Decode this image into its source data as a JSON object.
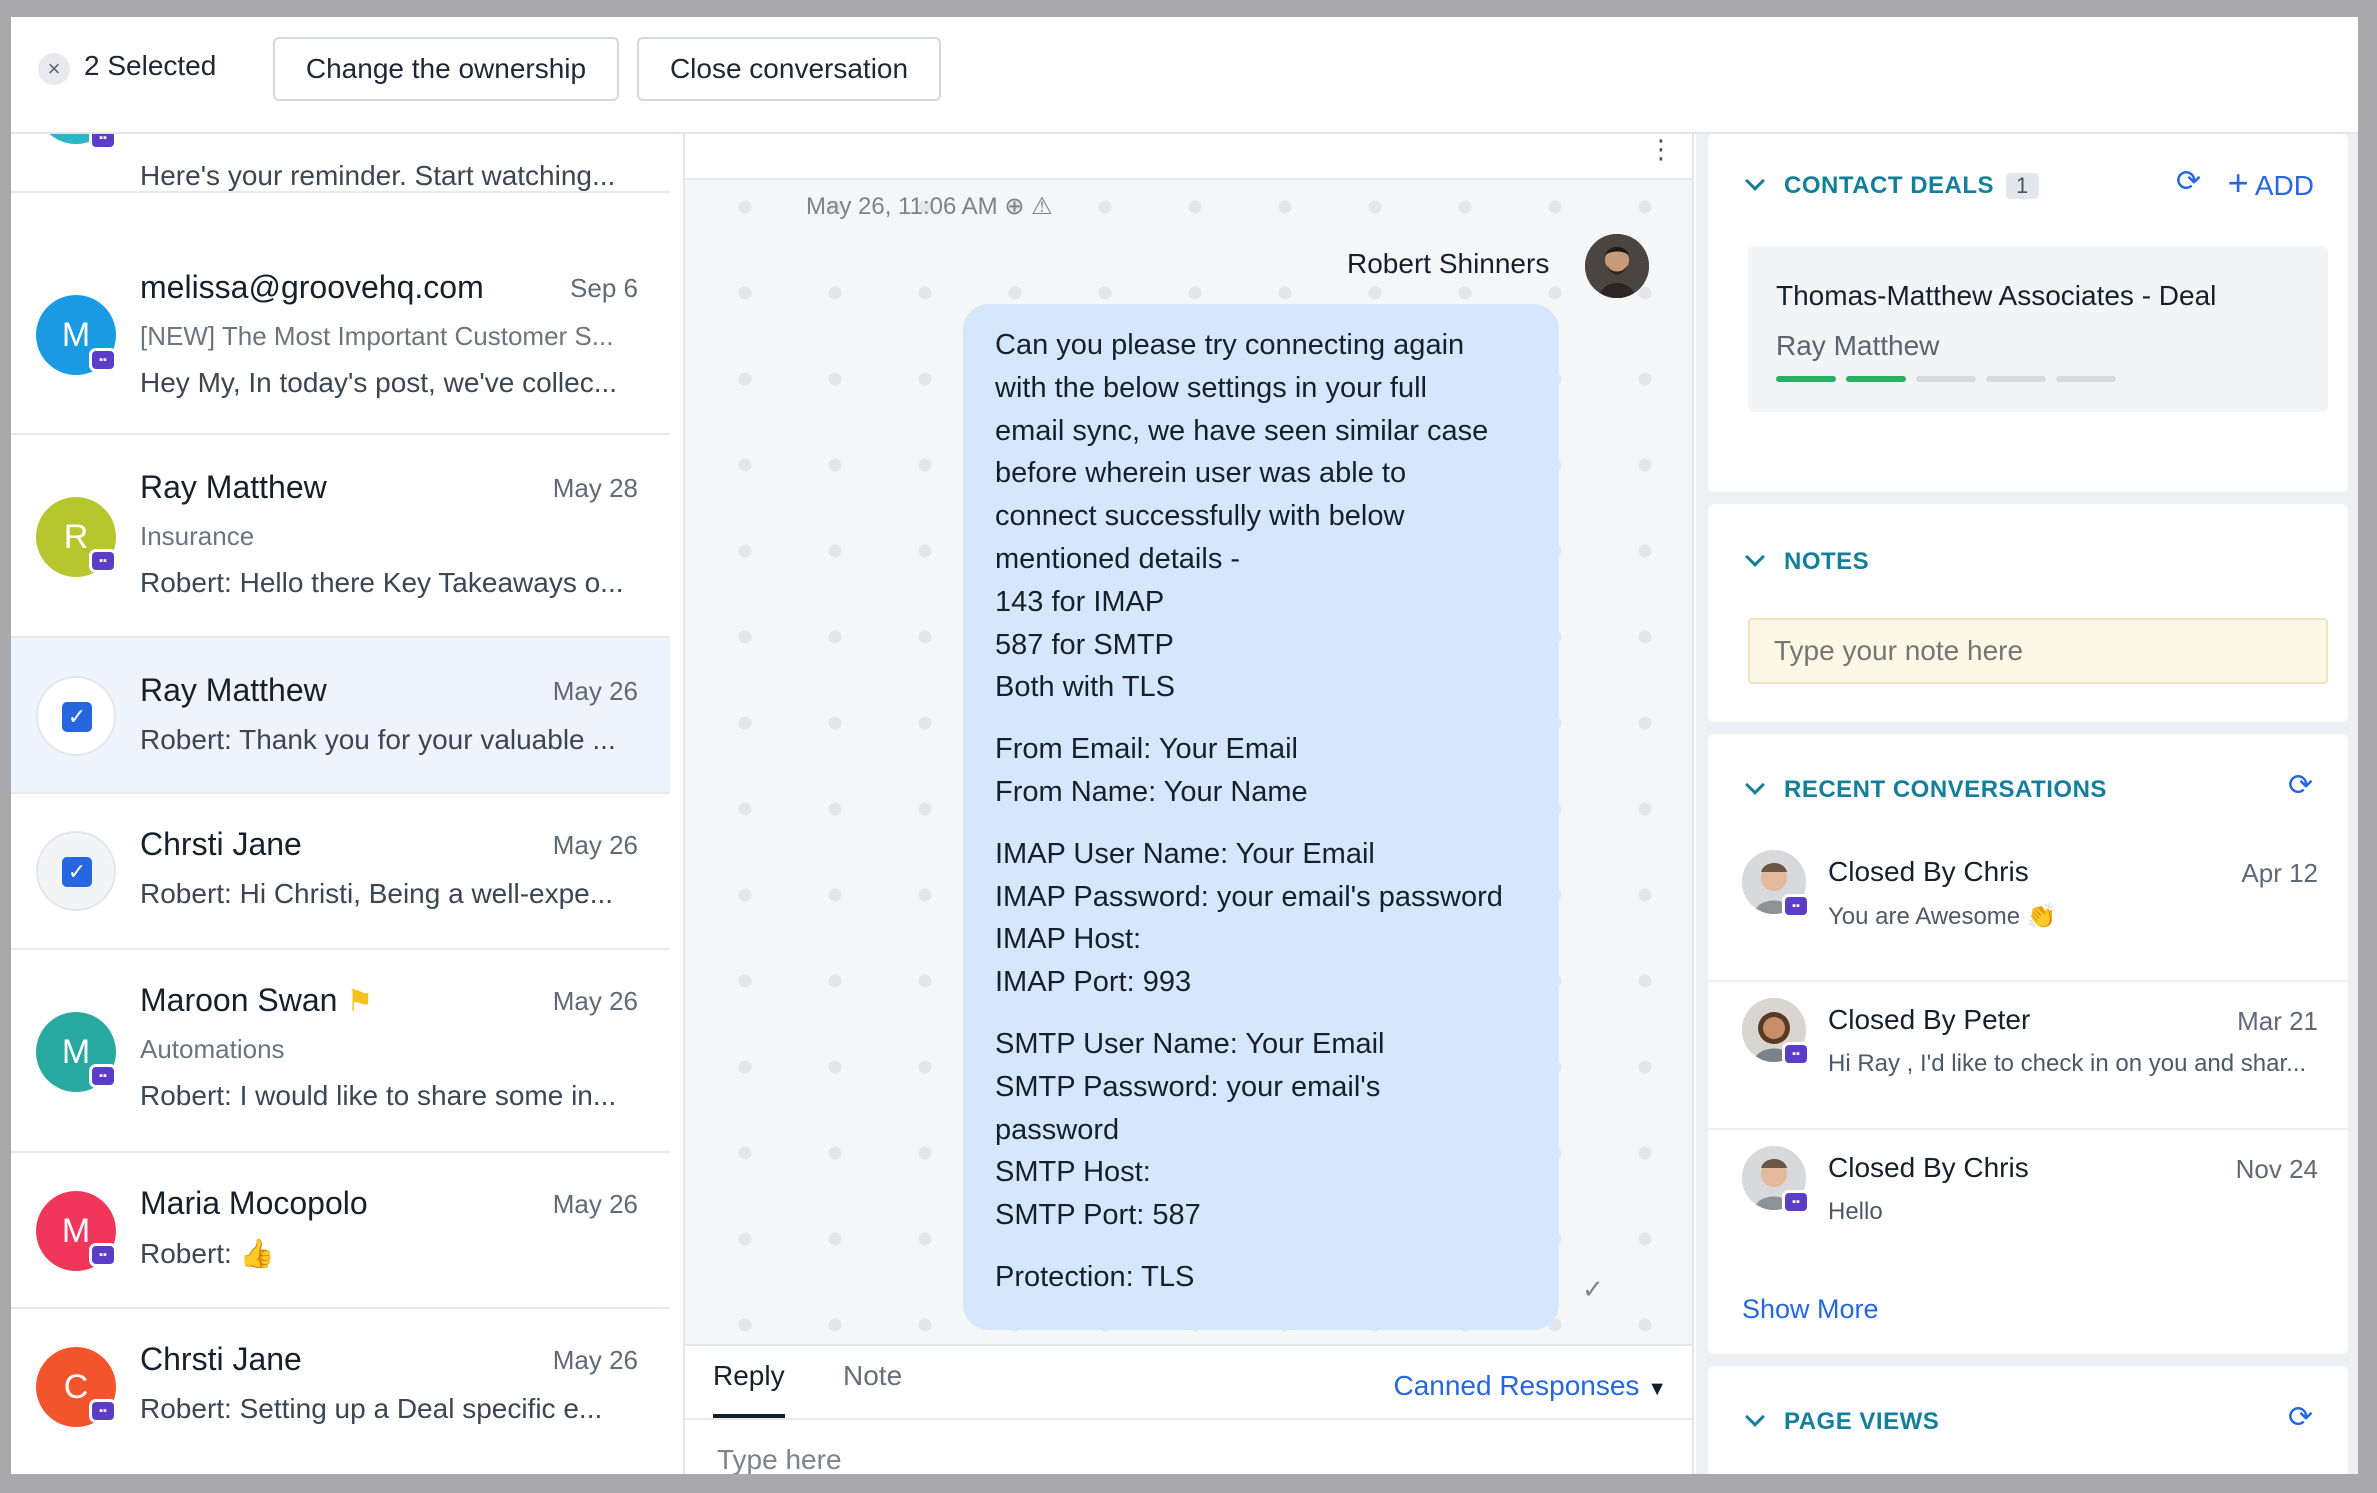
{
  "topbar": {
    "selected_label": "2 Selected",
    "change_owner_label": "Change the ownership",
    "close_conv_label": "Close conversation"
  },
  "conversations": [
    {
      "name": "",
      "date": "",
      "subject": "",
      "snippet": "Here's your reminder. Start watching...",
      "avatar_letter": "",
      "avatar_color": "#2bb5c4",
      "selected": false
    },
    {
      "name": "melissa@groovehq.com",
      "date": "Sep 6",
      "subject": "[NEW] The Most Important Customer S...",
      "snippet": "Hey My, In today's post, we've collec...",
      "avatar_letter": "M",
      "avatar_color": "#1b9ae4",
      "selected": false
    },
    {
      "name": "Ray Matthew",
      "date": "May 28",
      "subject": "Insurance",
      "snippet": "Robert: Hello there Key Takeaways o...",
      "avatar_letter": "R",
      "avatar_color": "#b5c62e",
      "selected": false
    },
    {
      "name": "Ray Matthew",
      "date": "May 26",
      "subject": "",
      "snippet": "Robert: Thank you for your valuable ...",
      "avatar_letter": "",
      "avatar_color": "",
      "selected": true
    },
    {
      "name": "Chrsti Jane",
      "date": "May 26",
      "subject": "",
      "snippet": "Robert: Hi Christi, Being a well-expe...",
      "avatar_letter": "",
      "avatar_color": "",
      "selected": true
    },
    {
      "name": "Maroon Swan",
      "date": "May 26",
      "subject": "Automations",
      "snippet": "Robert: I would like to share some in...",
      "avatar_letter": "M",
      "avatar_color": "#27a9a0",
      "selected": false
    },
    {
      "name": "Maria Mocopolo",
      "date": "May 26",
      "subject": "",
      "snippet": "Robert: 👍",
      "avatar_letter": "M",
      "avatar_color": "#f0365a",
      "selected": false
    },
    {
      "name": "Chrsti Jane",
      "date": "May 26",
      "subject": "",
      "snippet": "Robert: Setting up a Deal specific e...",
      "avatar_letter": "C",
      "avatar_color": "#f4542c",
      "selected": false
    }
  ],
  "chat": {
    "timestamp": "May 26, 11:06 AM",
    "sender": "Robert Shinners",
    "message_paragraphs": [
      [
        "Can you please try connecting again",
        "with the below settings in your full",
        "email sync, we have seen similar case",
        "before wherein user was able to",
        "connect successfully with below",
        "mentioned details -",
        "143 for IMAP",
        "587 for SMTP",
        "Both with TLS"
      ],
      [
        "From Email: Your Email",
        "From Name: Your Name"
      ],
      [
        "IMAP User Name: Your Email",
        "IMAP Password: your email's password",
        "IMAP Host:",
        "IMAP Port: 993"
      ],
      [
        "SMTP User Name: Your Email",
        "SMTP Password: your email's",
        "password",
        "SMTP Host:",
        "SMTP Port: 587"
      ],
      [
        "Protection: TLS"
      ]
    ]
  },
  "composer": {
    "tab_reply": "Reply",
    "tab_note": "Note",
    "canned_label": "Canned Responses",
    "placeholder": "Type here"
  },
  "sidebar": {
    "deals": {
      "heading": "CONTACT DEALS",
      "count": "1",
      "add_label": "ADD",
      "deal_title": "Thomas-Matthew Associates - Deal",
      "deal_owner": "Ray Matthew",
      "stages_completed": 2,
      "stages_total": 5,
      "complete_color": "#27ae60",
      "pending_color": "#d7dbe0"
    },
    "notes": {
      "heading": "NOTES",
      "placeholder": "Type your note here"
    },
    "recent": {
      "heading": "RECENT CONVERSATIONS",
      "items": [
        {
          "title": "Closed By Chris",
          "date": "Apr 12",
          "snippet": "You are Awesome 👏"
        },
        {
          "title": "Closed By Peter",
          "date": "Mar 21",
          "snippet": "Hi Ray , I'd like to check in on you and shar..."
        },
        {
          "title": "Closed By Chris",
          "date": "Nov 24",
          "snippet": "Hello"
        }
      ],
      "show_more": "Show More"
    },
    "page_views": {
      "heading": "PAGE VIEWS"
    }
  },
  "colors": {
    "accent": "#2667e0",
    "section_heading": "#137f9a",
    "bubble": "#d5e7fc"
  }
}
